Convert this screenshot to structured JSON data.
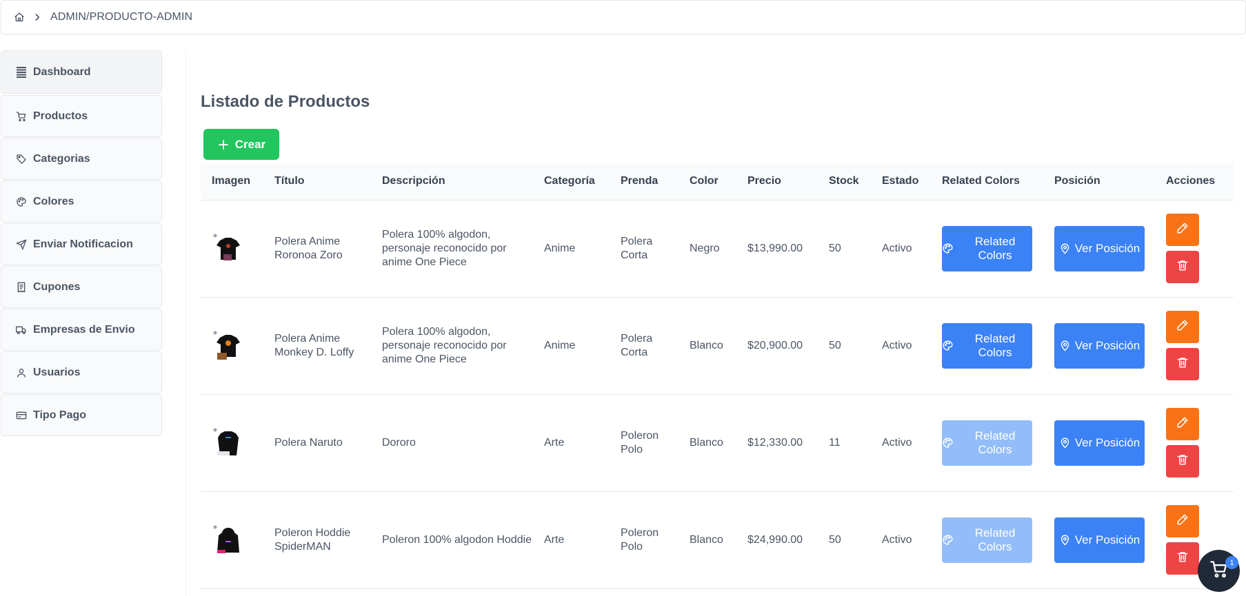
{
  "breadcrumb": {
    "path": "ADMIN/PRODUCTO-ADMIN"
  },
  "sidebar": {
    "items": [
      {
        "label": "Dashboard",
        "icon": "list-icon"
      },
      {
        "label": "Productos",
        "icon": "cart-icon"
      },
      {
        "label": "Categorias",
        "icon": "tag-icon"
      },
      {
        "label": "Colores",
        "icon": "palette-icon"
      },
      {
        "label": "Enviar Notificacion",
        "icon": "send-icon"
      },
      {
        "label": "Cupones",
        "icon": "receipt-icon"
      },
      {
        "label": "Empresas de Envio",
        "icon": "truck-icon"
      },
      {
        "label": "Usuarios",
        "icon": "user-icon"
      },
      {
        "label": "Tipo Pago",
        "icon": "credit-card-icon"
      }
    ]
  },
  "main": {
    "title": "Listado de Productos",
    "create_label": "Crear",
    "columns": [
      "Imagen",
      "Título",
      "Descripción",
      "Categoría",
      "Prenda",
      "Color",
      "Precio",
      "Stock",
      "Estado",
      "Related Colors",
      "Posición",
      "Acciones"
    ],
    "rows": [
      {
        "title": "Polera Anime Roronoa Zoro",
        "description": "Polera 100% algodon, personaje reconocido por anime One Piece",
        "category": "Anime",
        "garment": "Polera Corta",
        "color": "Negro",
        "price": "$13,990.00",
        "stock": "50",
        "status": "Activo",
        "related_label": "Related Colors",
        "related_enabled": true,
        "position_label": "Ver Posición",
        "thumb": "tshirt-black"
      },
      {
        "title": "Polera Anime Monkey D. Loffy",
        "description": "Polera 100% algodon, personaje reconocido por anime One Piece",
        "category": "Anime",
        "garment": "Polera Corta",
        "color": "Blanco",
        "price": "$20,900.00",
        "stock": "50",
        "status": "Activo",
        "related_label": "Related Colors",
        "related_enabled": true,
        "position_label": "Ver Posición",
        "thumb": "tshirt-black"
      },
      {
        "title": "Polera Naruto",
        "description": "Dororo",
        "category": "Arte",
        "garment": "Poleron Polo",
        "color": "Blanco",
        "price": "$12,330.00",
        "stock": "11",
        "status": "Activo",
        "related_label": "Related Colors",
        "related_enabled": false,
        "position_label": "Ver Posición",
        "thumb": "sweater-black"
      },
      {
        "title": "Poleron Hoddie SpiderMAN",
        "description": "Poleron 100% algodon Hoddie",
        "category": "Arte",
        "garment": "Poleron Polo",
        "color": "Blanco",
        "price": "$24,990.00",
        "stock": "50",
        "status": "Activo",
        "related_label": "Related Colors",
        "related_enabled": false,
        "position_label": "Ver Posición",
        "thumb": "hoodie-black"
      }
    ]
  },
  "cart": {
    "count": "1"
  },
  "colors": {
    "create": "#22c55e",
    "primary": "#3b82f6",
    "primary_disabled": "#93bdf9",
    "edit": "#f97316",
    "delete": "#ef4444"
  }
}
